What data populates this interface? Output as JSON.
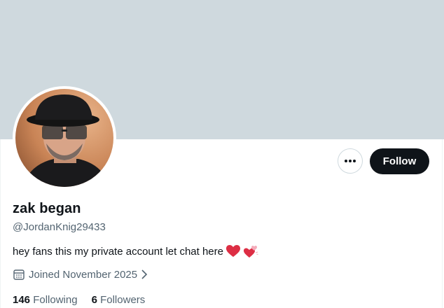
{
  "profile": {
    "display_name": "zak began",
    "handle": "@JordanKnig29433",
    "bio": "hey fans this my private account let chat here",
    "joined": "Joined November 2025",
    "following_count": "146",
    "following_label": "Following",
    "followers_count": "6",
    "followers_label": "Followers"
  },
  "actions": {
    "follow_label": "Follow"
  },
  "colors": {
    "banner": "#cfd9de",
    "primary_text": "#0f1419",
    "secondary_text": "#536471",
    "follow_button_bg": "#0f1419",
    "heart_red": "#e0245e"
  },
  "icons": {
    "more": "more-dots-icon",
    "calendar": "calendar-icon",
    "chevron": "chevron-right-icon",
    "heart": "red-heart-icon",
    "hearts": "two-hearts-icon"
  }
}
